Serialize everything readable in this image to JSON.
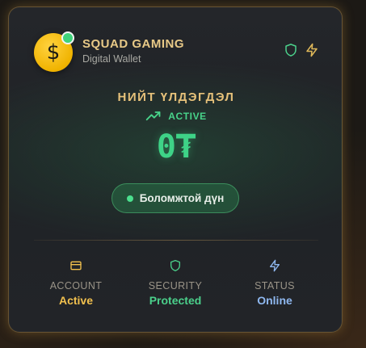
{
  "brand": {
    "name": "SQUAD GAMING",
    "subtitle": "Digital Wallet",
    "logo_icon": "dollar-coin-icon",
    "logo_glyph": "$"
  },
  "header_icons": [
    "shield-icon",
    "lightning-icon"
  ],
  "balance": {
    "label": "НИЙТ ҮЛДЭГДЭЛ",
    "status": "ACTIVE",
    "status_icon": "trending-up-icon",
    "amount": "0₮"
  },
  "available_button": {
    "label": "Боломжтой дүн"
  },
  "stats": [
    {
      "label": "ACCOUNT",
      "value": "Active",
      "icon": "card-icon",
      "color": "#f2c14e"
    },
    {
      "label": "SECURITY",
      "value": "Protected",
      "icon": "shield-icon",
      "color": "#4bd08b"
    },
    {
      "label": "STATUS",
      "value": "Online",
      "icon": "lightning-icon",
      "color": "#8fb8f0"
    }
  ],
  "colors": {
    "gold": "#e8c987",
    "green": "#3ed387",
    "blue": "#8fb8f0"
  }
}
